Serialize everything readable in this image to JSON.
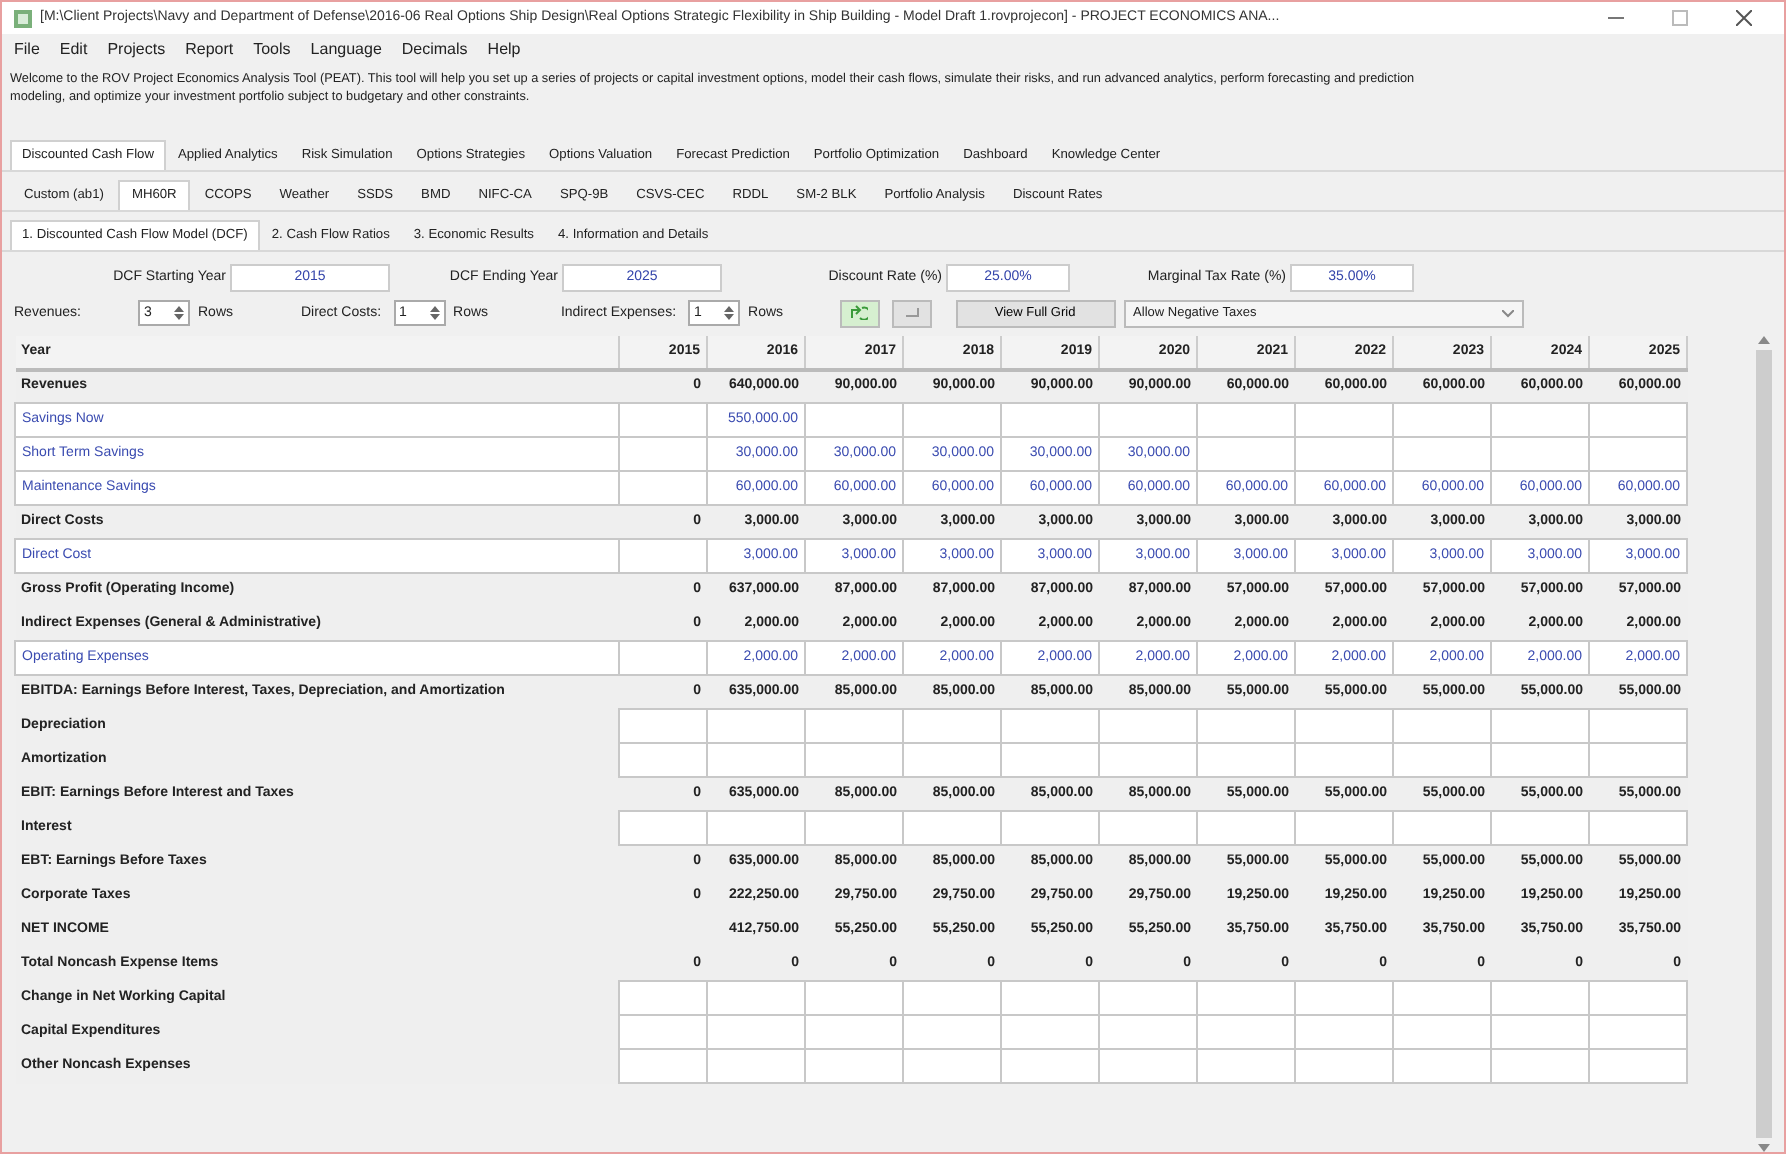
{
  "window": {
    "title": "[M:\\Client Projects\\Navy and Department of Defense\\2016-06 Real Options Ship Design\\Real Options Strategic Flexibility in Ship Building - Model Draft 1.rovprojecon] - PROJECT ECONOMICS ANA..."
  },
  "menu": [
    "File",
    "Edit",
    "Projects",
    "Report",
    "Tools",
    "Language",
    "Decimals",
    "Help"
  ],
  "welcome": [
    "Welcome to the ROV Project Economics Analysis Tool (PEAT). This tool will help you set up a series of projects or capital investment options, model their cash flows, simulate their risks, and run advanced analytics, perform forecasting and prediction",
    "modeling, and optimize your investment portfolio subject to budgetary and other constraints."
  ],
  "main_tabs": [
    {
      "label": "Discounted Cash Flow",
      "selected": true
    },
    {
      "label": "Applied Analytics",
      "selected": false
    },
    {
      "label": "Risk Simulation",
      "selected": false
    },
    {
      "label": "Options Strategies",
      "selected": false
    },
    {
      "label": "Options Valuation",
      "selected": false
    },
    {
      "label": "Forecast Prediction",
      "selected": false
    },
    {
      "label": "Portfolio Optimization",
      "selected": false
    },
    {
      "label": "Dashboard",
      "selected": false
    },
    {
      "label": "Knowledge Center",
      "selected": false
    }
  ],
  "project_tabs": [
    {
      "label": "Custom (ab1)",
      "selected": false
    },
    {
      "label": "MH60R",
      "selected": true
    },
    {
      "label": "CCOPS",
      "selected": false
    },
    {
      "label": "Weather",
      "selected": false
    },
    {
      "label": "SSDS",
      "selected": false
    },
    {
      "label": "BMD",
      "selected": false
    },
    {
      "label": "NIFC-CA",
      "selected": false
    },
    {
      "label": "SPQ-9B",
      "selected": false
    },
    {
      "label": "CSVS-CEC",
      "selected": false
    },
    {
      "label": "RDDL",
      "selected": false
    },
    {
      "label": "SM-2 BLK",
      "selected": false
    },
    {
      "label": "Portfolio Analysis",
      "selected": false
    },
    {
      "label": "Discount Rates",
      "selected": false
    }
  ],
  "model_tabs": [
    {
      "label": "1. Discounted Cash Flow Model (DCF)",
      "selected": true
    },
    {
      "label": "2. Cash Flow Ratios",
      "selected": false
    },
    {
      "label": "3. Economic Results",
      "selected": false
    },
    {
      "label": "4. Information and Details",
      "selected": false
    }
  ],
  "fields": [
    {
      "label": "DCF Starting Year",
      "value": "2015"
    },
    {
      "label": "DCF Ending Year",
      "value": "2025"
    },
    {
      "label": "Discount Rate (%)",
      "value": "25.00%"
    },
    {
      "label": "Marginal Tax Rate (%)",
      "value": "35.00%"
    }
  ],
  "row_counts": [
    {
      "label": "Revenues:",
      "value": "3",
      "unit": "Rows"
    },
    {
      "label": "Direct Costs:",
      "value": "1",
      "unit": "Rows"
    },
    {
      "label": "Indirect Expenses:",
      "value": "1",
      "unit": "Rows"
    }
  ],
  "view_button": "View Full Grid",
  "tax_option": "Allow Negative Taxes",
  "table": {
    "columns": [
      "Year",
      "2015",
      "2016",
      "2017",
      "2018",
      "2019",
      "2020",
      "2021",
      "2022",
      "2023",
      "2024",
      "2025"
    ],
    "rows": [
      {
        "kind": "total",
        "label": "Revenues",
        "values": [
          "0",
          "640,000.00",
          "90,000.00",
          "90,000.00",
          "90,000.00",
          "90,000.00",
          "60,000.00",
          "60,000.00",
          "60,000.00",
          "60,000.00",
          "60,000.00"
        ]
      },
      {
        "kind": "input",
        "label": "Savings Now",
        "values": [
          {
            "kind": "blank"
          },
          "550,000.00",
          {
            "kind": "blank"
          },
          {
            "kind": "blank"
          },
          {
            "kind": "blank"
          },
          {
            "kind": "blank"
          },
          {
            "kind": "blank"
          },
          {
            "kind": "blank"
          },
          {
            "kind": "blank"
          },
          {
            "kind": "blank"
          },
          {
            "kind": "blank"
          }
        ]
      },
      {
        "kind": "input",
        "label": "Short Term Savings",
        "values": [
          {
            "kind": "blank"
          },
          "30,000.00",
          "30,000.00",
          "30,000.00",
          "30,000.00",
          "30,000.00",
          {
            "kind": "blank"
          },
          {
            "kind": "blank"
          },
          {
            "kind": "blank"
          },
          {
            "kind": "blank"
          },
          {
            "kind": "blank"
          }
        ]
      },
      {
        "kind": "input",
        "label": "Maintenance Savings",
        "values": [
          {
            "kind": "blank"
          },
          "60,000.00",
          "60,000.00",
          "60,000.00",
          "60,000.00",
          "60,000.00",
          "60,000.00",
          "60,000.00",
          "60,000.00",
          "60,000.00",
          "60,000.00"
        ]
      },
      {
        "kind": "total",
        "label": "Direct Costs",
        "values": [
          "0",
          "3,000.00",
          "3,000.00",
          "3,000.00",
          "3,000.00",
          "3,000.00",
          "3,000.00",
          "3,000.00",
          "3,000.00",
          "3,000.00",
          "3,000.00"
        ]
      },
      {
        "kind": "input",
        "label": "Direct Cost",
        "values": [
          {
            "kind": "blank"
          },
          "3,000.00",
          "3,000.00",
          "3,000.00",
          "3,000.00",
          "3,000.00",
          "3,000.00",
          "3,000.00",
          "3,000.00",
          "3,000.00",
          "3,000.00"
        ]
      },
      {
        "kind": "total",
        "label": "Gross Profit (Operating Income)",
        "values": [
          "0",
          "637,000.00",
          "87,000.00",
          "87,000.00",
          "87,000.00",
          "87,000.00",
          "57,000.00",
          "57,000.00",
          "57,000.00",
          "57,000.00",
          "57,000.00"
        ]
      },
      {
        "kind": "total",
        "label": "Indirect Expenses (General & Administrative)",
        "values": [
          "0",
          "2,000.00",
          "2,000.00",
          "2,000.00",
          "2,000.00",
          "2,000.00",
          "2,000.00",
          "2,000.00",
          "2,000.00",
          "2,000.00",
          "2,000.00"
        ]
      },
      {
        "kind": "input",
        "label": "Operating Expenses",
        "values": [
          {
            "kind": "blank"
          },
          "2,000.00",
          "2,000.00",
          "2,000.00",
          "2,000.00",
          "2,000.00",
          "2,000.00",
          "2,000.00",
          "2,000.00",
          "2,000.00",
          "2,000.00"
        ]
      },
      {
        "kind": "total",
        "label": "EBITDA: Earnings Before Interest, Taxes, Depreciation, and Amortization",
        "values": [
          "0",
          "635,000.00",
          "85,000.00",
          "85,000.00",
          "85,000.00",
          "85,000.00",
          "55,000.00",
          "55,000.00",
          "55,000.00",
          "55,000.00",
          "55,000.00"
        ]
      },
      {
        "kind": "entry",
        "label": "Depreciation"
      },
      {
        "kind": "entry",
        "label": "Amortization"
      },
      {
        "kind": "total",
        "label": "EBIT: Earnings Before Interest and Taxes",
        "values": [
          "0",
          "635,000.00",
          "85,000.00",
          "85,000.00",
          "85,000.00",
          "85,000.00",
          "55,000.00",
          "55,000.00",
          "55,000.00",
          "55,000.00",
          "55,000.00"
        ]
      },
      {
        "kind": "entry",
        "label": "Interest"
      },
      {
        "kind": "total",
        "label": "EBT: Earnings Before Taxes",
        "values": [
          "0",
          "635,000.00",
          "85,000.00",
          "85,000.00",
          "85,000.00",
          "85,000.00",
          "55,000.00",
          "55,000.00",
          "55,000.00",
          "55,000.00",
          "55,000.00"
        ]
      },
      {
        "kind": "total",
        "label": "Corporate Taxes",
        "values": [
          "0",
          "222,250.00",
          "29,750.00",
          "29,750.00",
          "29,750.00",
          "29,750.00",
          "19,250.00",
          "19,250.00",
          "19,250.00",
          "19,250.00",
          "19,250.00"
        ]
      },
      {
        "kind": "total",
        "label": "NET INCOME",
        "values": [
          {
            "kind": "blank"
          },
          "412,750.00",
          "55,250.00",
          "55,250.00",
          "55,250.00",
          "55,250.00",
          "35,750.00",
          "35,750.00",
          "35,750.00",
          "35,750.00",
          "35,750.00"
        ]
      },
      {
        "kind": "total",
        "label": "Total Noncash Expense Items",
        "values": [
          "0",
          "0",
          "0",
          "0",
          "0",
          "0",
          "0",
          "0",
          "0",
          "0",
          "0"
        ]
      },
      {
        "kind": "entry",
        "label": "Change in Net Working Capital"
      },
      {
        "kind": "entry",
        "label": "Capital Expenditures"
      },
      {
        "kind": "entry",
        "label": "Other Noncash Expenses"
      }
    ]
  }
}
